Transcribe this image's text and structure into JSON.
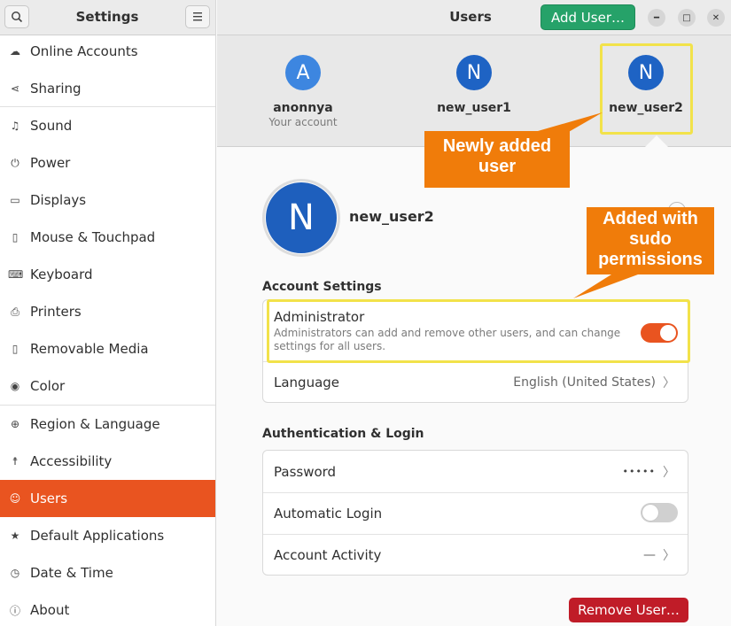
{
  "sidebar": {
    "title": "Settings",
    "items": [
      {
        "label": "Online Accounts",
        "icon": "cloud-icon",
        "glyph": "☁"
      },
      {
        "label": "Sharing",
        "icon": "share-icon",
        "glyph": "⋖"
      },
      {
        "label": "Sound",
        "icon": "music-note-icon",
        "glyph": "♫"
      },
      {
        "label": "Power",
        "icon": "power-icon",
        "glyph": "⏻"
      },
      {
        "label": "Displays",
        "icon": "display-icon",
        "glyph": "▭"
      },
      {
        "label": "Mouse & Touchpad",
        "icon": "mouse-icon",
        "glyph": "▯"
      },
      {
        "label": "Keyboard",
        "icon": "keyboard-icon",
        "glyph": "⌨"
      },
      {
        "label": "Printers",
        "icon": "printer-icon",
        "glyph": "⎙"
      },
      {
        "label": "Removable Media",
        "icon": "removable-media-icon",
        "glyph": "▯"
      },
      {
        "label": "Color",
        "icon": "color-icon",
        "glyph": "◉"
      },
      {
        "label": "Region & Language",
        "icon": "globe-icon",
        "glyph": "⊕"
      },
      {
        "label": "Accessibility",
        "icon": "accessibility-icon",
        "glyph": "☨"
      },
      {
        "label": "Users",
        "icon": "users-icon",
        "glyph": "☺"
      },
      {
        "label": "Default Applications",
        "icon": "star-icon",
        "glyph": "★"
      },
      {
        "label": "Date & Time",
        "icon": "clock-icon",
        "glyph": "◷"
      },
      {
        "label": "About",
        "icon": "info-icon",
        "glyph": "ⓘ"
      }
    ]
  },
  "header": {
    "title": "Users",
    "add_user_label": "Add User…"
  },
  "carousel": {
    "users": [
      {
        "initial": "A",
        "name": "anonnya",
        "subtitle": "Your account"
      },
      {
        "initial": "N",
        "name": "new_user1",
        "subtitle": ""
      },
      {
        "initial": "N",
        "name": "new_user2",
        "subtitle": ""
      }
    ]
  },
  "profile": {
    "initial": "N",
    "name": "new_user2"
  },
  "account_settings": {
    "title": "Account Settings",
    "administrator_label": "Administrator",
    "administrator_desc": "Administrators can add and remove other users, and can change settings for all users.",
    "language_label": "Language",
    "language_value": "English (United States)"
  },
  "auth": {
    "title": "Authentication & Login",
    "password_label": "Password",
    "password_value": "•••••",
    "auto_login_label": "Automatic Login",
    "activity_label": "Account Activity",
    "activity_value": "—"
  },
  "remove_user_label": "Remove User…",
  "annotations": {
    "newly_added": "Newly added user",
    "sudo": "Added with sudo permissions"
  },
  "colors": {
    "accent": "#e95420",
    "add_button": "#26a269",
    "remove_button": "#c01c28",
    "callout": "#f07c0a",
    "highlight": "#f2e24a"
  }
}
